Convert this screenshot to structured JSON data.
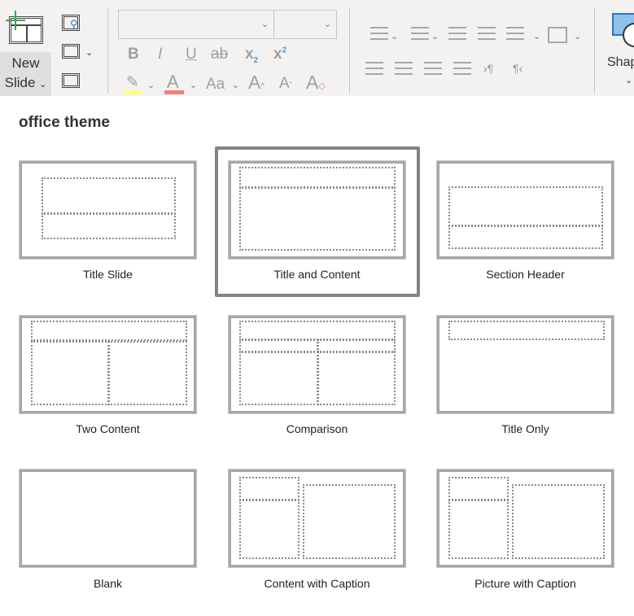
{
  "ribbon": {
    "new_slide": {
      "line1": "New",
      "line2": "Slide"
    },
    "shapes_label": "Shap",
    "font_name": "",
    "font_size": "",
    "format": {
      "bold": "B",
      "italic": "I",
      "underline": "U",
      "strike": "ab",
      "subscript": "x",
      "superscript": "x",
      "change_case": "Aa",
      "grow": "A",
      "shrink": "A",
      "clear": "A",
      "font_color": "A"
    },
    "colors": {
      "highlight": "#ffff80",
      "font_color": "#f08080",
      "accent_green": "#3aa655",
      "icon_blue": "#4a9ede"
    }
  },
  "gallery": {
    "heading": "office theme",
    "selected": "Title and Content",
    "layouts": [
      {
        "label": "Title Slide"
      },
      {
        "label": "Title and Content"
      },
      {
        "label": "Section Header"
      },
      {
        "label": "Two Content"
      },
      {
        "label": "Comparison"
      },
      {
        "label": "Title Only"
      },
      {
        "label": "Blank"
      },
      {
        "label": "Content with Caption"
      },
      {
        "label": "Picture with Caption"
      }
    ]
  }
}
